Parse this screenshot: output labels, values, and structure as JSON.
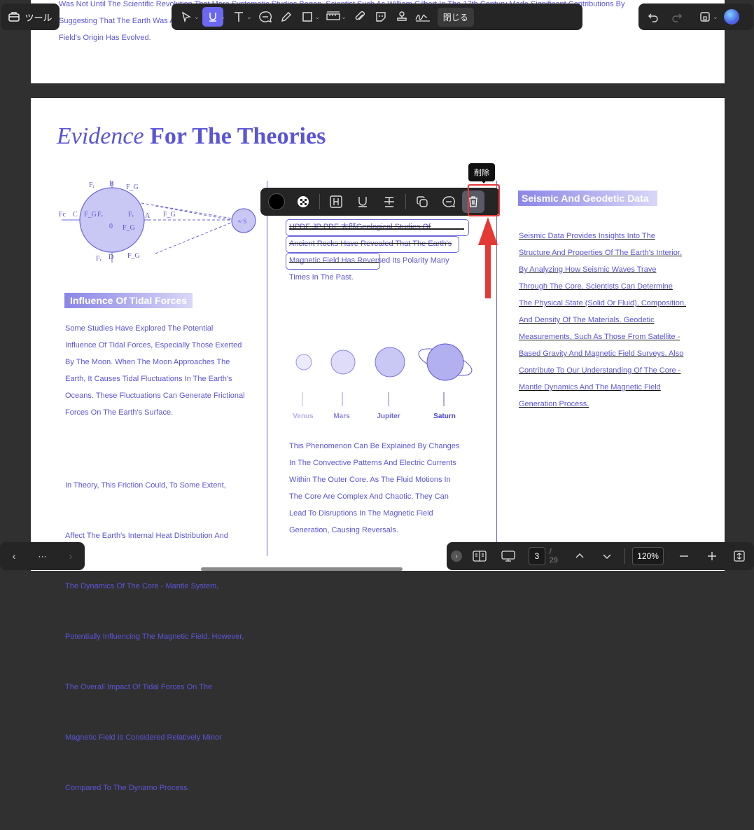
{
  "tools_button": {
    "label": "ツール"
  },
  "toolbar": {
    "close_label": "閉じる",
    "tools": [
      "select-tool",
      "underline-tool",
      "text-tool",
      "comment-tool",
      "pencil-tool",
      "shape-tool",
      "measure-tool",
      "attach-tool",
      "sticker-tool",
      "stamp-tool",
      "signature-tool"
    ]
  },
  "top_page": {
    "lines": [
      "Was Not Until The Scientific Revolution That More Systematic Studies Began. Scientist Such As William Gilbert In The 17th Century Made Significant Contributions By",
      "Suggesting That The Earth Was A Giant Magnet. Since Then, Our Understanding Of The Magnet",
      "Field's Origin Has Evolved."
    ]
  },
  "main_page": {
    "title_italic": "Evidence",
    "title_bold": "For The Theories",
    "diagram_labels": {
      "fr_top": "Fᵣ",
      "b": "B",
      "fg_top": "F_G",
      "fc": "Fc",
      "c": "C",
      "fg_left": "F_G",
      "fr_left": "Fᵣ",
      "zero": "0",
      "fr_right": "Fᵣ",
      "a": "A",
      "fg_right": "F_G",
      "fg_bottom_mid": "F_G",
      "fr_bottom": "Fᵣ",
      "d": "D",
      "fg_bottom": "F_G"
    },
    "tidal": {
      "heading": "Influence Of Tidal Forces",
      "para1": [
        "Some Studies Have Explored The Potential",
        "Influence Of Tidal Forces, Especially Those Exerted",
        "By The Moon. When The Moon Approaches The",
        "Earth, It Causes Tidal Fluctuations In The Earth's",
        "Oceans. These Fluctuations Can Generate Frictional",
        "Forces On The Earth's Surface."
      ],
      "para2": [
        " In Theory, This Friction Could, To Some Extent,",
        "Affect The Earth's Internal Heat Distribution And",
        "The Dynamics Of The Core - Mantle System,",
        "Potentially Influencing The Magnetic Field. However,",
        "The Overall Impact Of Tidal Forces On The",
        "Magnetic Field Is Considered Relatively Minor",
        "Compared To The Dynamo Process."
      ]
    },
    "middle": {
      "strike_lines": [
        "UPDF JP PDF 太郎Geological Studies Of",
        "Ancient Rocks Have Revealed That The Earth's",
        "Magnetic Field Has Reversed Its Polarity Many"
      ],
      "last_line": "Times In The Past.",
      "planets": [
        "Venus",
        "Mars",
        "Jupiter",
        "Saturn"
      ],
      "para": [
        "This Phenomenon Can Be Explained By Changes",
        "In The Convective Patterns And Electric Currents",
        "Within The Outer Core. As The Fluid Motions In",
        "The Core Are Complex And Chaotic, They Can",
        "Lead To Disruptions In The Magnetic Field",
        "Generation, Causing Reversals."
      ]
    },
    "seismic": {
      "heading": "Seismic And Geodetic Data",
      "lines": [
        "Seismic Data Provides Insights Into The",
        "Structure And Properties Of The Earth's Interior.",
        "By Analyzing How Seismic Waves Trave",
        "Through The Core, Scientists Can Determine",
        "The Physical State (Solid Or Fluid), Composition,",
        "And Density Of The Materials. Geodetic",
        "Measurements, Such As Those From Satellite -",
        "Based Gravity And Magnetic Field Surveys, Also",
        "Contribute To Our Understanding Of The Core -",
        "Mantle Dynamics And The Magnetic Field",
        "Generation Process."
      ]
    }
  },
  "float_toolbar": {
    "tooltip": "削除",
    "tools": [
      "color-swatch",
      "opacity-pattern",
      "highlight-tool",
      "underline-tool",
      "strikethrough-tool",
      "copy-tool",
      "comment-tool",
      "delete-tool"
    ]
  },
  "bottom_bar": {
    "page_current": "3",
    "page_total": "/ 29",
    "zoom": "120%",
    "more": "···"
  },
  "colors": {
    "accent": "#5b55d6",
    "highlight_red": "#e53935",
    "toolbar_bg": "#252525"
  }
}
